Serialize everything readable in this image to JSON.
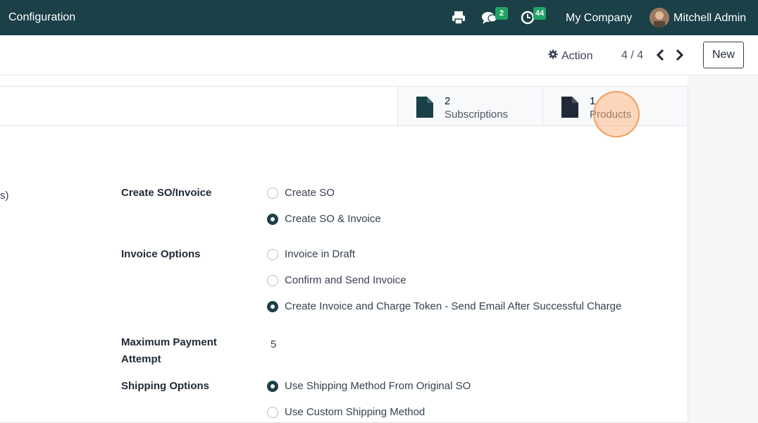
{
  "navbar": {
    "title": "Configuration",
    "messages_badge": "2",
    "activities_badge": "44",
    "company": "My Company",
    "user": "Mitchell Admin",
    "bg_color": "#1b4048",
    "badge_color": "#21a365"
  },
  "control_panel": {
    "action_label": "Action",
    "pager": "4 / 4",
    "new_label": "New"
  },
  "button_box": [
    {
      "value": "2",
      "label": "Subscriptions",
      "icon": "document-icon"
    },
    {
      "value": "1",
      "label": "Products",
      "icon": "document-icon"
    }
  ],
  "form": {
    "cut_text": "s)",
    "create_so": {
      "label": "Create SO/Invoice",
      "options": [
        {
          "label": "Create SO",
          "checked": false
        },
        {
          "label": "Create SO & Invoice",
          "checked": true
        }
      ]
    },
    "invoice_options": {
      "label": "Invoice Options",
      "options": [
        {
          "label": "Invoice in Draft",
          "checked": false
        },
        {
          "label": "Confirm and Send Invoice",
          "checked": false
        },
        {
          "label": "Create Invoice and Charge Token - Send Email After Successful Charge",
          "checked": true
        }
      ]
    },
    "max_payment": {
      "label_line1": "Maximum Payment",
      "label_line2": "Attempt",
      "value": "5"
    },
    "shipping": {
      "label": "Shipping Options",
      "options": [
        {
          "label": "Use Shipping Method From Original SO",
          "checked": true
        },
        {
          "label": "Use Custom Shipping Method",
          "checked": false
        }
      ]
    }
  }
}
